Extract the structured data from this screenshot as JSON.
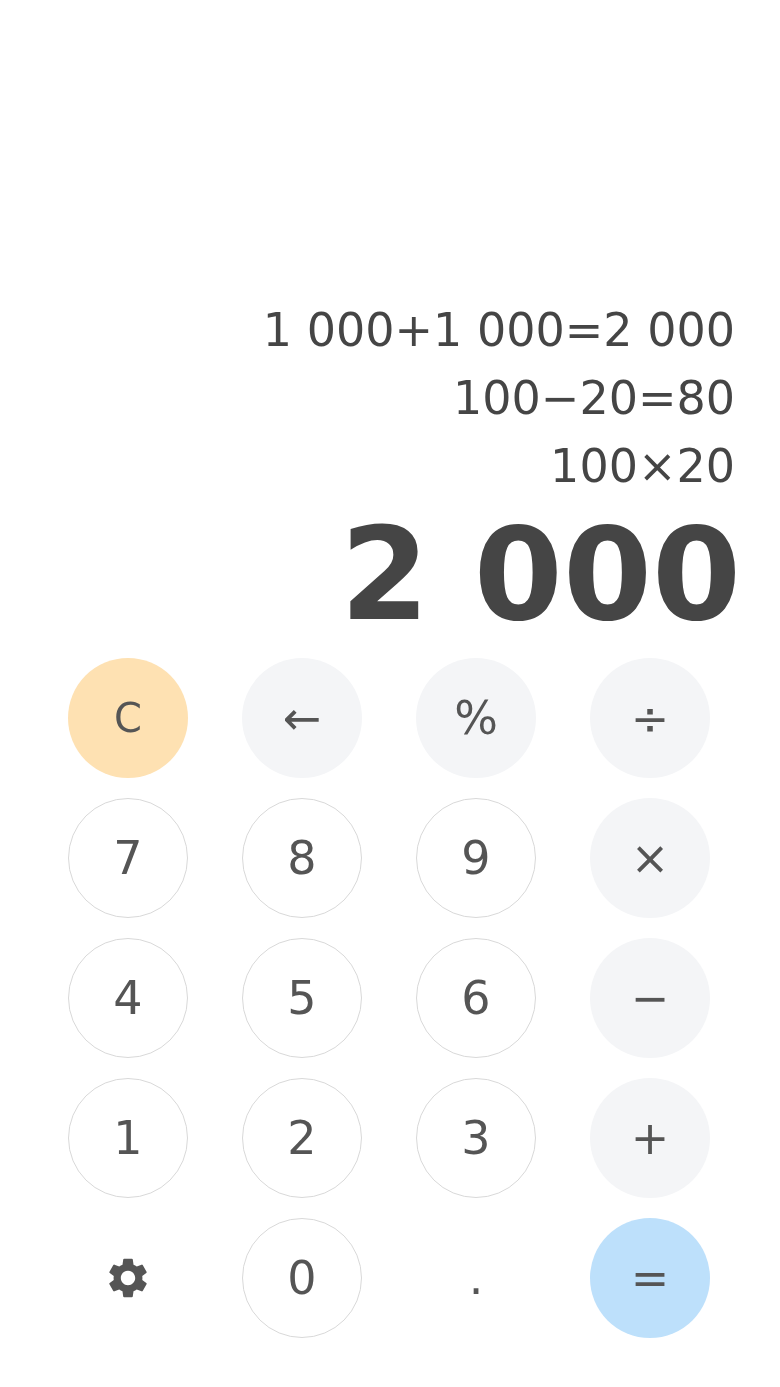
{
  "display": {
    "history": [
      "1 000+1 000=2 000",
      "100−20=80",
      "100×20"
    ],
    "result": "2 000"
  },
  "keys": [
    {
      "kind": "clear",
      "label": "C"
    },
    {
      "kind": "op",
      "label": "←"
    },
    {
      "kind": "op",
      "label": "%"
    },
    {
      "kind": "op",
      "label": "÷"
    },
    {
      "kind": "digit",
      "label": "7"
    },
    {
      "kind": "digit",
      "label": "8"
    },
    {
      "kind": "digit",
      "label": "9"
    },
    {
      "kind": "op",
      "label": "×"
    },
    {
      "kind": "digit",
      "label": "4"
    },
    {
      "kind": "digit",
      "label": "5"
    },
    {
      "kind": "digit",
      "label": "6"
    },
    {
      "kind": "op",
      "label": "−"
    },
    {
      "kind": "digit",
      "label": "1"
    },
    {
      "kind": "digit",
      "label": "2"
    },
    {
      "kind": "digit",
      "label": "3"
    },
    {
      "kind": "op",
      "label": "+"
    },
    {
      "kind": "settings"
    },
    {
      "kind": "digit",
      "label": "0"
    },
    {
      "kind": "plain",
      "label": "."
    },
    {
      "kind": "equals",
      "label": "="
    }
  ]
}
